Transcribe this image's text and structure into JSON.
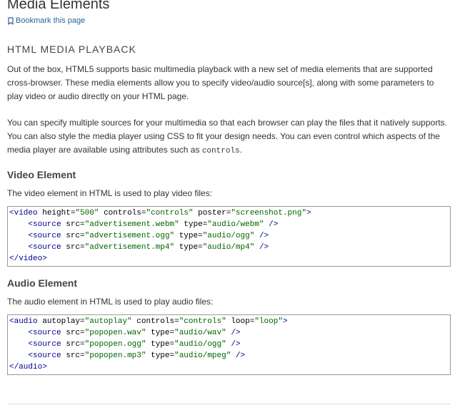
{
  "page": {
    "title": "Media Elements",
    "bookmark_label": "Bookmark this page"
  },
  "section": {
    "heading": "HTML MEDIA PLAYBACK",
    "paragraph1": "Out of the box, HTML5 supports basic multimedia playback with a new set of media elements that are supported cross-browser. These media elements allow you to specify video/audio source[s], along with some parameters to play video or audio directly on your HTML page.",
    "paragraph2_before": "You can specify multiple sources for your multimedia so that each browser can play the files that it natively supports. You can also style the media player using CSS to fit your design needs. You can even control which aspects of the media player are available using attributes such as ",
    "paragraph2_code": "controls",
    "paragraph2_after": "."
  },
  "video": {
    "heading": "Video Element",
    "description": "The video element in HTML is used to play video files:",
    "code_lines": [
      "<video height=\"500\" controls=\"controls\" poster=\"screenshot.png\">",
      "    <source src=\"advertisement.webm\" type=\"audio/webm\" />",
      "    <source src=\"advertisement.ogg\" type=\"audio/ogg\" />",
      "    <source src=\"advertisement.mp4\" type=\"audio/mp4\" />",
      "</video>"
    ]
  },
  "audio": {
    "heading": "Audio Element",
    "description": "The audio element in HTML is used to play audio files:",
    "code_lines": [
      "<audio autoplay=\"autoplay\" controls=\"controls\" loop=\"loop\">",
      "    <source src=\"popopen.wav\" type=\"audio/wav\" />",
      "    <source src=\"popopen.ogg\" type=\"audio/ogg\" />",
      "    <source src=\"popopen.mp3\" type=\"audio/mpeg\" />",
      "</audio>"
    ]
  },
  "icons": {
    "bookmark": "bookmark-icon"
  },
  "colors": {
    "link": "#2a6496",
    "code_border": "#999999",
    "tag": "#00008b",
    "value": "#006400"
  }
}
